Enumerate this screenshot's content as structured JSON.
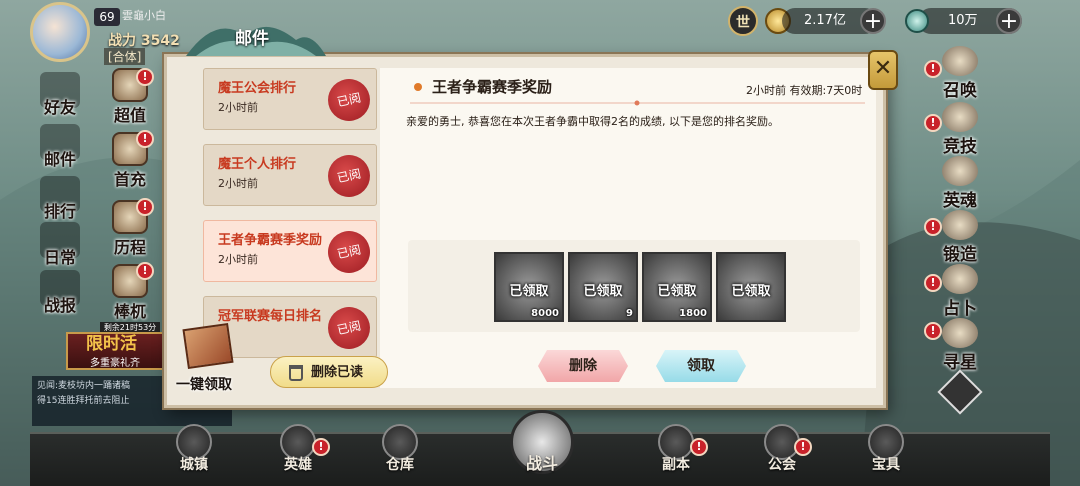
{
  "player": {
    "level": "69",
    "name": "雲龜小白",
    "power": "战力 3542",
    "alliance": "[合体]"
  },
  "currency": {
    "badge": "世",
    "gold": "2.17亿",
    "jade": "10万",
    "plus": "+"
  },
  "left_menu": [
    {
      "label": "好友"
    },
    {
      "label": "超值",
      "badge": "!"
    },
    {
      "label": "邮件"
    },
    {
      "label": "首充",
      "badge": "!"
    },
    {
      "label": "排行"
    },
    {
      "label": "历程",
      "badge": "!"
    },
    {
      "label": "日常"
    },
    {
      "label": "棒杌",
      "badge": "!",
      "sub": "剩余21时53分"
    },
    {
      "label": "战报"
    }
  ],
  "limited": {
    "title": "限时活",
    "sub": "多重豪礼齐"
  },
  "chat": {
    "lines": [
      "见闻:麦枝坊内一踊诸稿",
      "得15连胜拜托前去阻止"
    ]
  },
  "right_menu": [
    {
      "label": "召唤",
      "badge": "!"
    },
    {
      "label": "竞技",
      "badge": "!"
    },
    {
      "label": "英魂"
    },
    {
      "label": "锻造",
      "badge": "!"
    },
    {
      "label": "占卜",
      "badge": "!"
    },
    {
      "label": "寻星",
      "badge": "!"
    }
  ],
  "mail": {
    "tab_title": "邮件",
    "list": [
      {
        "title": "魔王公会排行",
        "time": "2小时前",
        "seal": "已阅"
      },
      {
        "title": "魔王个人排行",
        "time": "2小时前",
        "seal": "已阅"
      },
      {
        "title": "王者争霸赛季奖励",
        "time": "2小时前",
        "seal": "已阅"
      },
      {
        "title": "冠军联赛每日排名",
        "time": "",
        "seal": "已阅"
      }
    ],
    "detail": {
      "title": "王者争霸赛季奖励",
      "time": "2小时前 有效期:7天0时",
      "body": "亲爱的勇士, 恭喜您在本次王者争霸中取得2名的成绩, 以下是您的排名奖励。",
      "rewards": [
        {
          "status": "已领取",
          "count": "8000"
        },
        {
          "status": "已领取",
          "count": "9"
        },
        {
          "status": "已领取",
          "count": "1800"
        },
        {
          "status": "已领取",
          "count": ""
        }
      ]
    },
    "buttons": {
      "delete": "删除",
      "claim": "领取",
      "delete_read": "删除已读",
      "claim_all": "一键领取"
    },
    "close": "✕"
  },
  "bottom_nav": [
    {
      "label": "城镇"
    },
    {
      "label": "英雄",
      "badge": "!"
    },
    {
      "label": "仓库"
    },
    {
      "label": "战斗"
    },
    {
      "label": "副本",
      "badge": "!"
    },
    {
      "label": "公会",
      "badge": "!"
    },
    {
      "label": "宝具"
    }
  ]
}
